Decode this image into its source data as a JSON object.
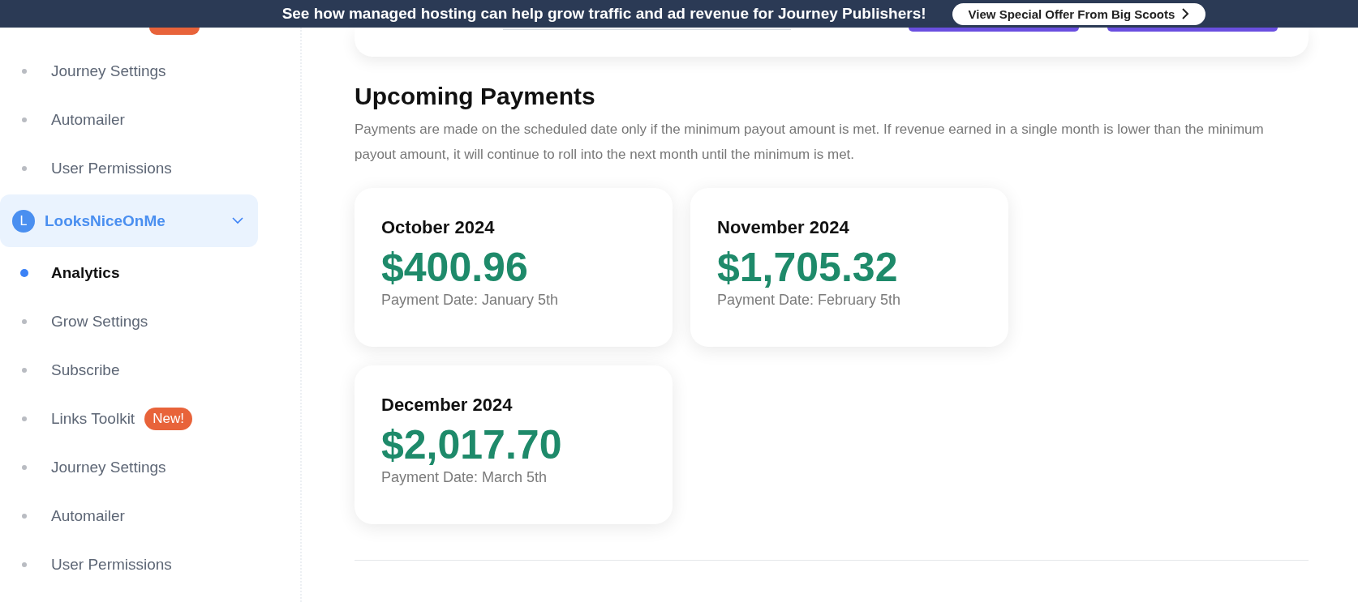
{
  "banner": {
    "message": "See how managed hosting can help grow traffic and ad revenue for Journey Publishers!",
    "button": "View Special Offer From Big Scoots"
  },
  "sidebar": {
    "items": [
      {
        "kind": "item",
        "label": "Journey Settings",
        "selected": false
      },
      {
        "kind": "item",
        "label": "Automailer",
        "selected": false
      },
      {
        "kind": "item",
        "label": "User Permissions",
        "selected": false
      },
      {
        "kind": "site",
        "label": "LooksNiceOnMe",
        "avatar": "L",
        "expanded": true
      },
      {
        "kind": "item",
        "label": "Analytics",
        "selected": true
      },
      {
        "kind": "item",
        "label": "Grow Settings",
        "selected": false
      },
      {
        "kind": "item",
        "label": "Subscribe",
        "selected": false
      },
      {
        "kind": "item",
        "label": "Links Toolkit",
        "badge": "New!",
        "selected": false
      },
      {
        "kind": "item",
        "label": "Journey Settings",
        "selected": false
      },
      {
        "kind": "item",
        "label": "Automailer",
        "selected": false
      },
      {
        "kind": "item",
        "label": "User Permissions",
        "selected": false
      }
    ]
  },
  "upcoming_payments": {
    "title": "Upcoming Payments",
    "description": "Payments are made on the scheduled date only if the minimum payout amount is met. If revenue earned in a single month is lower than the minimum payout amount, it will continue to roll into the next month until the minimum is met.",
    "cards": [
      {
        "month": "October 2024",
        "amount": "$400.96",
        "payment_date": "Payment Date: January 5th"
      },
      {
        "month": "November 2024",
        "amount": "$1,705.32",
        "payment_date": "Payment Date: February 5th"
      },
      {
        "month": "December 2024",
        "amount": "$2,017.70",
        "payment_date": "Payment Date: March 5th"
      }
    ]
  }
}
